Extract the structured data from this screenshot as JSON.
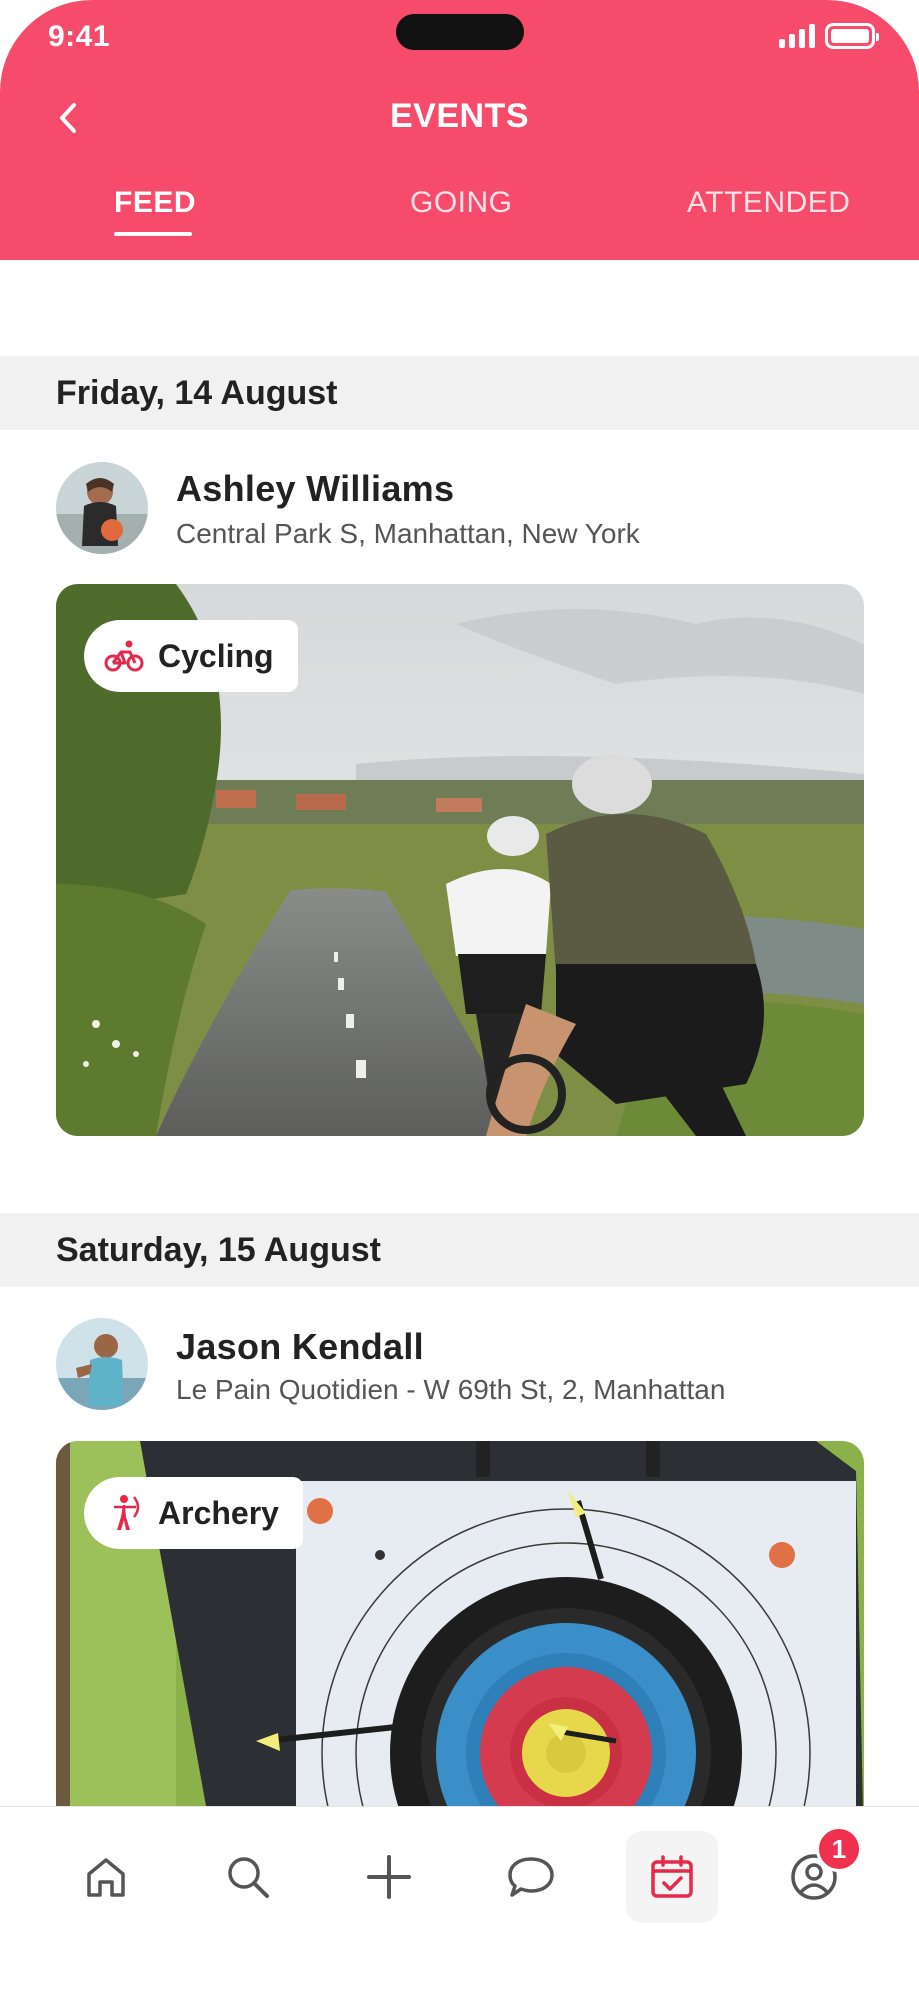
{
  "status_bar": {
    "time": "9:41"
  },
  "header": {
    "title": "EVENTS",
    "tabs": [
      {
        "label": "FEED",
        "active": true
      },
      {
        "label": "GOING",
        "active": false
      },
      {
        "label": "ATTENDED",
        "active": false
      }
    ]
  },
  "feed": [
    {
      "date": "Friday, 14 August",
      "host_name": "Ashley Williams",
      "location": "Central Park S, Manhattan, New York",
      "category": "Cycling",
      "category_icon": "bicycle-icon"
    },
    {
      "date": "Saturday, 15 August",
      "host_name": "Jason Kendall",
      "location": "Le Pain Quotidien - W 69th St, 2, Manhattan",
      "category": "Archery",
      "category_icon": "archer-icon"
    }
  ],
  "bottom_nav": {
    "items": [
      "home-icon",
      "search-icon",
      "plus-icon",
      "chat-icon",
      "calendar-check-icon",
      "profile-icon"
    ],
    "active": "calendar-check-icon",
    "profile_badge": "1"
  },
  "colors": {
    "accent": "#f64b6b",
    "badge": "#f0304f"
  }
}
